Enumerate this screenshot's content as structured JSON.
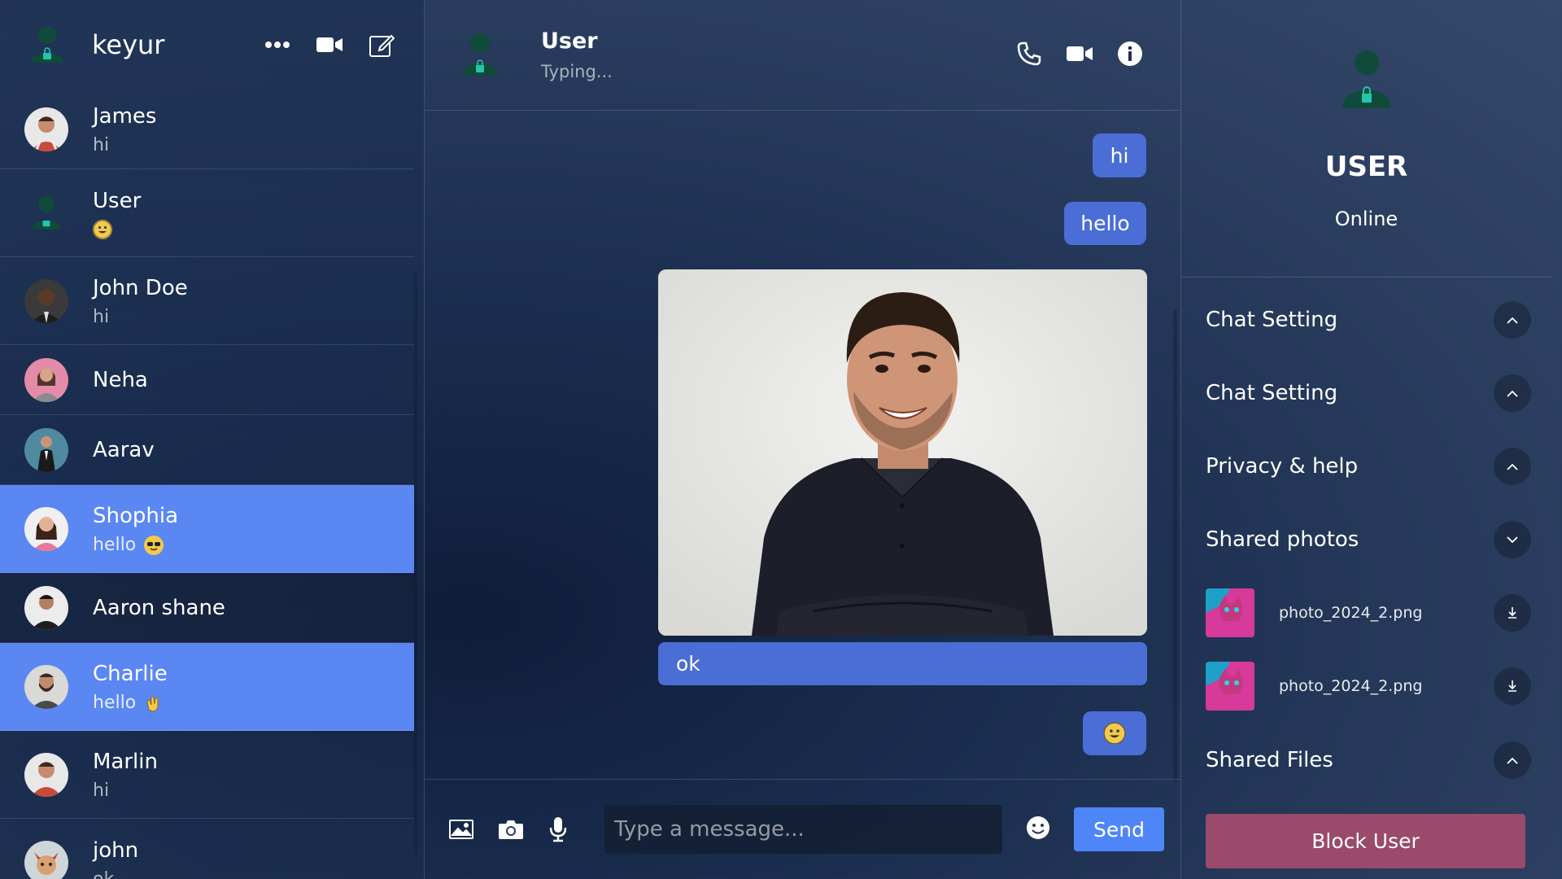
{
  "current_user": {
    "name": "keyur",
    "avatar_icon": "user-lock-icon"
  },
  "sidebar_actions": [
    {
      "name": "more-options-icon"
    },
    {
      "name": "video-call-icon"
    },
    {
      "name": "compose-icon"
    }
  ],
  "contacts": [
    {
      "name": "James",
      "last": "hi",
      "emoji": null,
      "active": false
    },
    {
      "name": "User",
      "last": "",
      "emoji": "grinning",
      "active": false
    },
    {
      "name": "John Doe",
      "last": "hi",
      "emoji": null,
      "active": false
    },
    {
      "name": "Neha",
      "last": "",
      "emoji": null,
      "active": false
    },
    {
      "name": "Aarav",
      "last": "",
      "emoji": null,
      "active": false
    },
    {
      "name": "Shophia",
      "last": "hello",
      "emoji": "sunglasses",
      "active": true
    },
    {
      "name": "Aaron shane",
      "last": "",
      "emoji": null,
      "active": false
    },
    {
      "name": "Charlie",
      "last": "hello",
      "emoji": "clap",
      "active": true
    },
    {
      "name": "Marlin",
      "last": "hi",
      "emoji": null,
      "active": false
    },
    {
      "name": "john",
      "last": "ok",
      "emoji": null,
      "active": false
    }
  ],
  "chat": {
    "name": "User",
    "status": "Typing...",
    "messages": {
      "m1": "hi",
      "m2": "hello",
      "caption": "ok"
    },
    "input_placeholder": "Type a message...",
    "send_label": "Send"
  },
  "profile": {
    "name": "USER",
    "status": "Online",
    "sections": {
      "chat_setting_1": "Chat Setting",
      "chat_setting_2": "Chat Setting",
      "privacy": "Privacy & help",
      "shared_photos": "Shared photos",
      "shared_files": "Shared Files"
    },
    "photos": [
      {
        "filename": "photo_2024_2.png"
      },
      {
        "filename": "photo_2024_2.png"
      }
    ],
    "block_label": "Block User"
  },
  "colors": {
    "active_contact": "#5a87f2",
    "bubble": "#4a6ed5",
    "send_button": "#4f86f7",
    "block_button": "#9a4a6a",
    "avatar_green": "#0f4a3a",
    "lock_teal": "#21c7a8"
  }
}
